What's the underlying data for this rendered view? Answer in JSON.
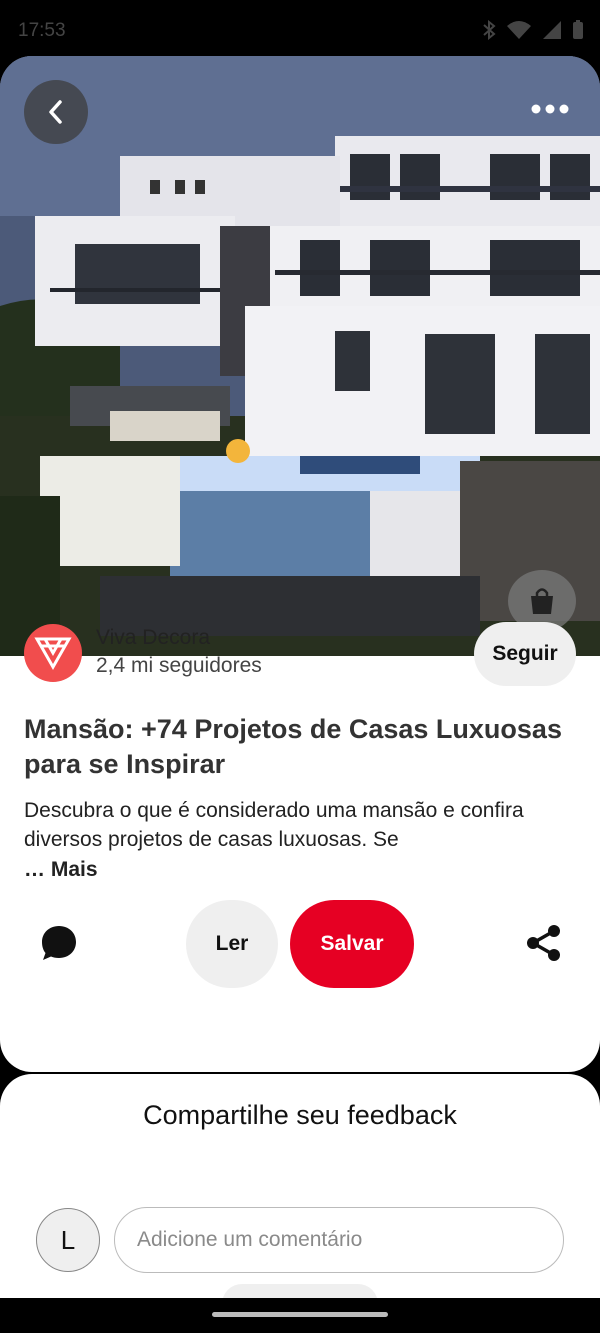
{
  "status_bar": {
    "time": "17:53"
  },
  "pin": {
    "author": {
      "name": "Viva Decora",
      "followers": "2,4 mi seguidores",
      "follow_label": "Seguir"
    },
    "title": "Mansão: +74 Projetos de Casas Luxuosas para se Inspirar",
    "description": "Descubra o que é considerado uma mansão e confira diversos projetos de casas luxuosas. Se",
    "more_label": "… Mais",
    "actions": {
      "read_label": "Ler",
      "save_label": "Salvar"
    },
    "colors": {
      "save": "#e60023",
      "author_logo": "#f14d4d"
    },
    "icons": [
      "back-arrow-icon",
      "more-options-icon",
      "visual-search-icon",
      "comment-icon",
      "share-icon",
      "viva-decora-logo-icon"
    ]
  },
  "feedback": {
    "title": "Compartilhe seu feedback",
    "user_initial": "L",
    "comment_placeholder": "Adicione um comentário"
  }
}
